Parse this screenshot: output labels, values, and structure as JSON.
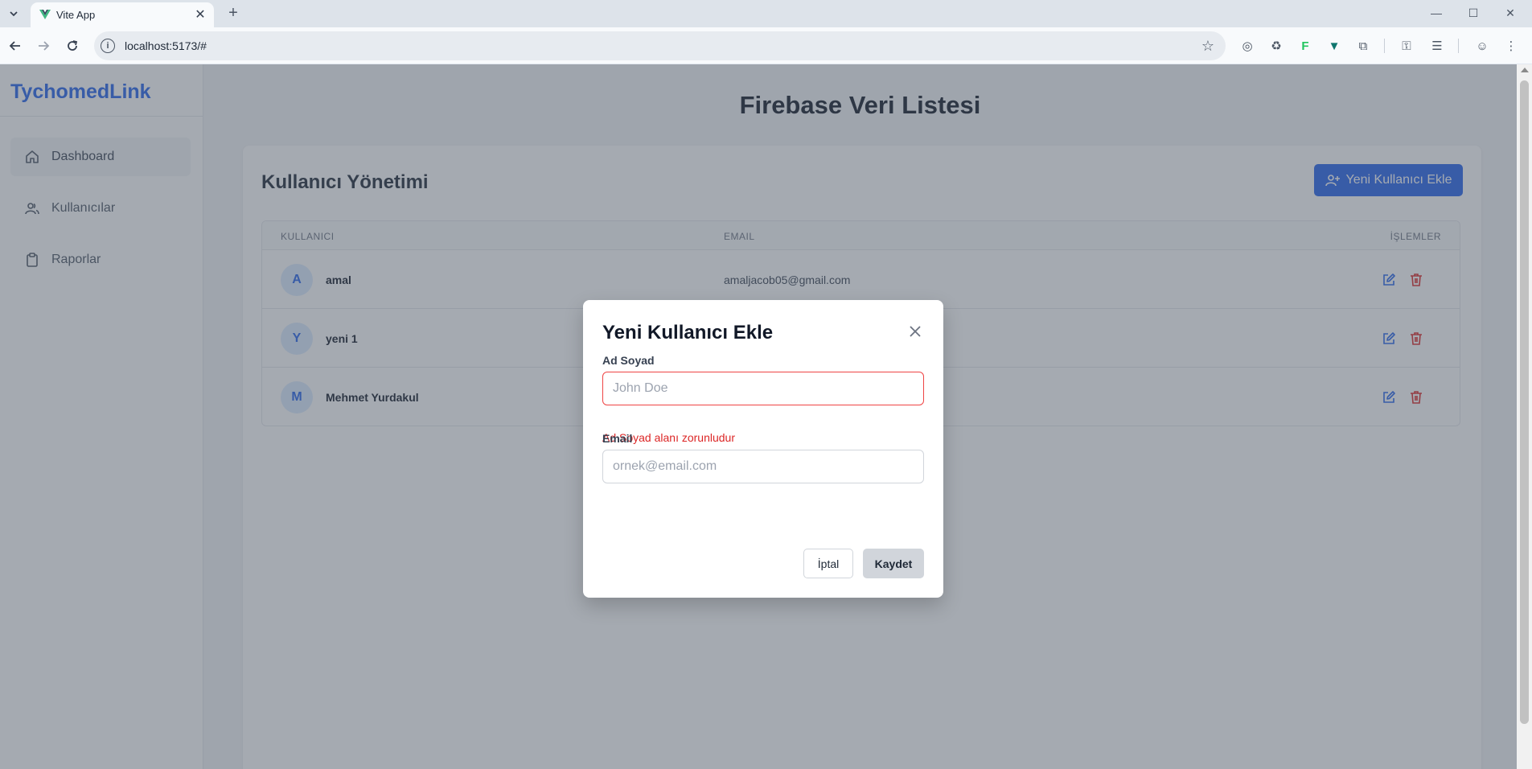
{
  "browser": {
    "tab_title": "Vite App",
    "url": "localhost:5173/#",
    "extension_letter": "F"
  },
  "sidebar": {
    "brand": "TychomedLink",
    "items": [
      {
        "label": "Dashboard",
        "icon": "home-icon",
        "active": true
      },
      {
        "label": "Kullanıcılar",
        "icon": "users-icon",
        "active": false
      },
      {
        "label": "Raporlar",
        "icon": "clipboard-icon",
        "active": false
      }
    ]
  },
  "main": {
    "page_title": "Firebase Veri Listesi",
    "card_title": "Kullanıcı Yönetimi",
    "add_button_label": "Yeni Kullanıcı Ekle",
    "table": {
      "headers": {
        "user": "KULLANICI",
        "email": "EMAIL",
        "actions": "İŞLEMLER"
      },
      "rows": [
        {
          "initial": "A",
          "name": "amal",
          "email": "amaljacob05@gmail.com"
        },
        {
          "initial": "Y",
          "name": "yeni 1",
          "email": ""
        },
        {
          "initial": "M",
          "name": "Mehmet Yurdakul",
          "email": ""
        }
      ]
    }
  },
  "modal": {
    "title": "Yeni Kullanıcı Ekle",
    "name_label": "Ad Soyad",
    "name_placeholder": "John Doe",
    "name_value": "",
    "name_error": "Ad Soyad alanı zorunludur",
    "email_label": "Email",
    "email_placeholder": "ornek@email.com",
    "email_value": "",
    "cancel_label": "İptal",
    "save_label": "Kaydet"
  },
  "colors": {
    "accent": "#2563eb",
    "error": "#dc2626",
    "delete": "#dc2626"
  }
}
